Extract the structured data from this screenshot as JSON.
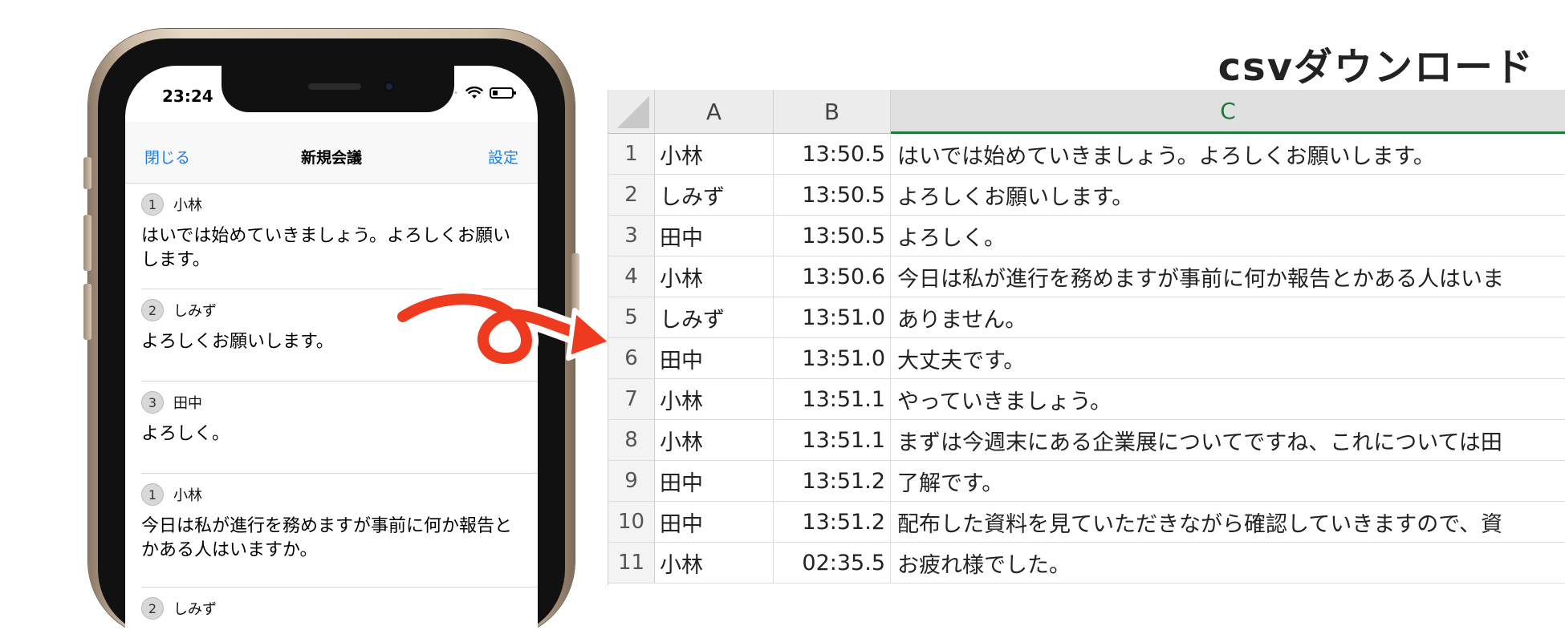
{
  "status_bar": {
    "time": "23:24"
  },
  "navbar": {
    "close_label": "閉じる",
    "title": "新規会議",
    "settings_label": "設定"
  },
  "messages": [
    {
      "number": "1",
      "speaker": "小林",
      "text": "はいでは始めていきましょう。よろしくお願いします。"
    },
    {
      "number": "2",
      "speaker": "しみず",
      "text": "よろしくお願いします。"
    },
    {
      "number": "3",
      "speaker": "田中",
      "text": "よろしく。"
    },
    {
      "number": "1",
      "speaker": "小林",
      "text": "今日は私が進行を務めますが事前に何か報告とかある人はいますか。"
    },
    {
      "number": "2",
      "speaker": "しみず",
      "text": ""
    }
  ],
  "title": "csvダウンロード",
  "sheet": {
    "columns": [
      "A",
      "B",
      "C"
    ],
    "rows": [
      {
        "num": "1",
        "a": "小林",
        "b": "13:50.5",
        "c": "はいでは始めていきましょう。よろしくお願いします。"
      },
      {
        "num": "2",
        "a": "しみず",
        "b": "13:50.5",
        "c": "よろしくお願いします。"
      },
      {
        "num": "3",
        "a": "田中",
        "b": "13:50.5",
        "c": "よろしく。"
      },
      {
        "num": "4",
        "a": "小林",
        "b": "13:50.6",
        "c": "今日は私が進行を務めますが事前に何か報告とかある人はいま"
      },
      {
        "num": "5",
        "a": "しみず",
        "b": "13:51.0",
        "c": "ありません。"
      },
      {
        "num": "6",
        "a": "田中",
        "b": "13:51.0",
        "c": "大丈夫です。"
      },
      {
        "num": "7",
        "a": "小林",
        "b": "13:51.1",
        "c": "やっていきましょう。"
      },
      {
        "num": "8",
        "a": "小林",
        "b": "13:51.1",
        "c": "まずは今週末にある企業展についてですね、これについては田"
      },
      {
        "num": "9",
        "a": "田中",
        "b": "13:51.2",
        "c": "了解です。"
      },
      {
        "num": "10",
        "a": "田中",
        "b": "13:51.2",
        "c": "配布した資料を見ていただきながら確認していきますので、資"
      },
      {
        "num": "11",
        "a": "小林",
        "b": "02:35.5",
        "c": "お疲れ様でした。"
      }
    ]
  },
  "colors": {
    "accent_blue": "#1a7ee6",
    "arrow_red": "#ee3a1f",
    "active_column_green": "#1e7a3c"
  }
}
